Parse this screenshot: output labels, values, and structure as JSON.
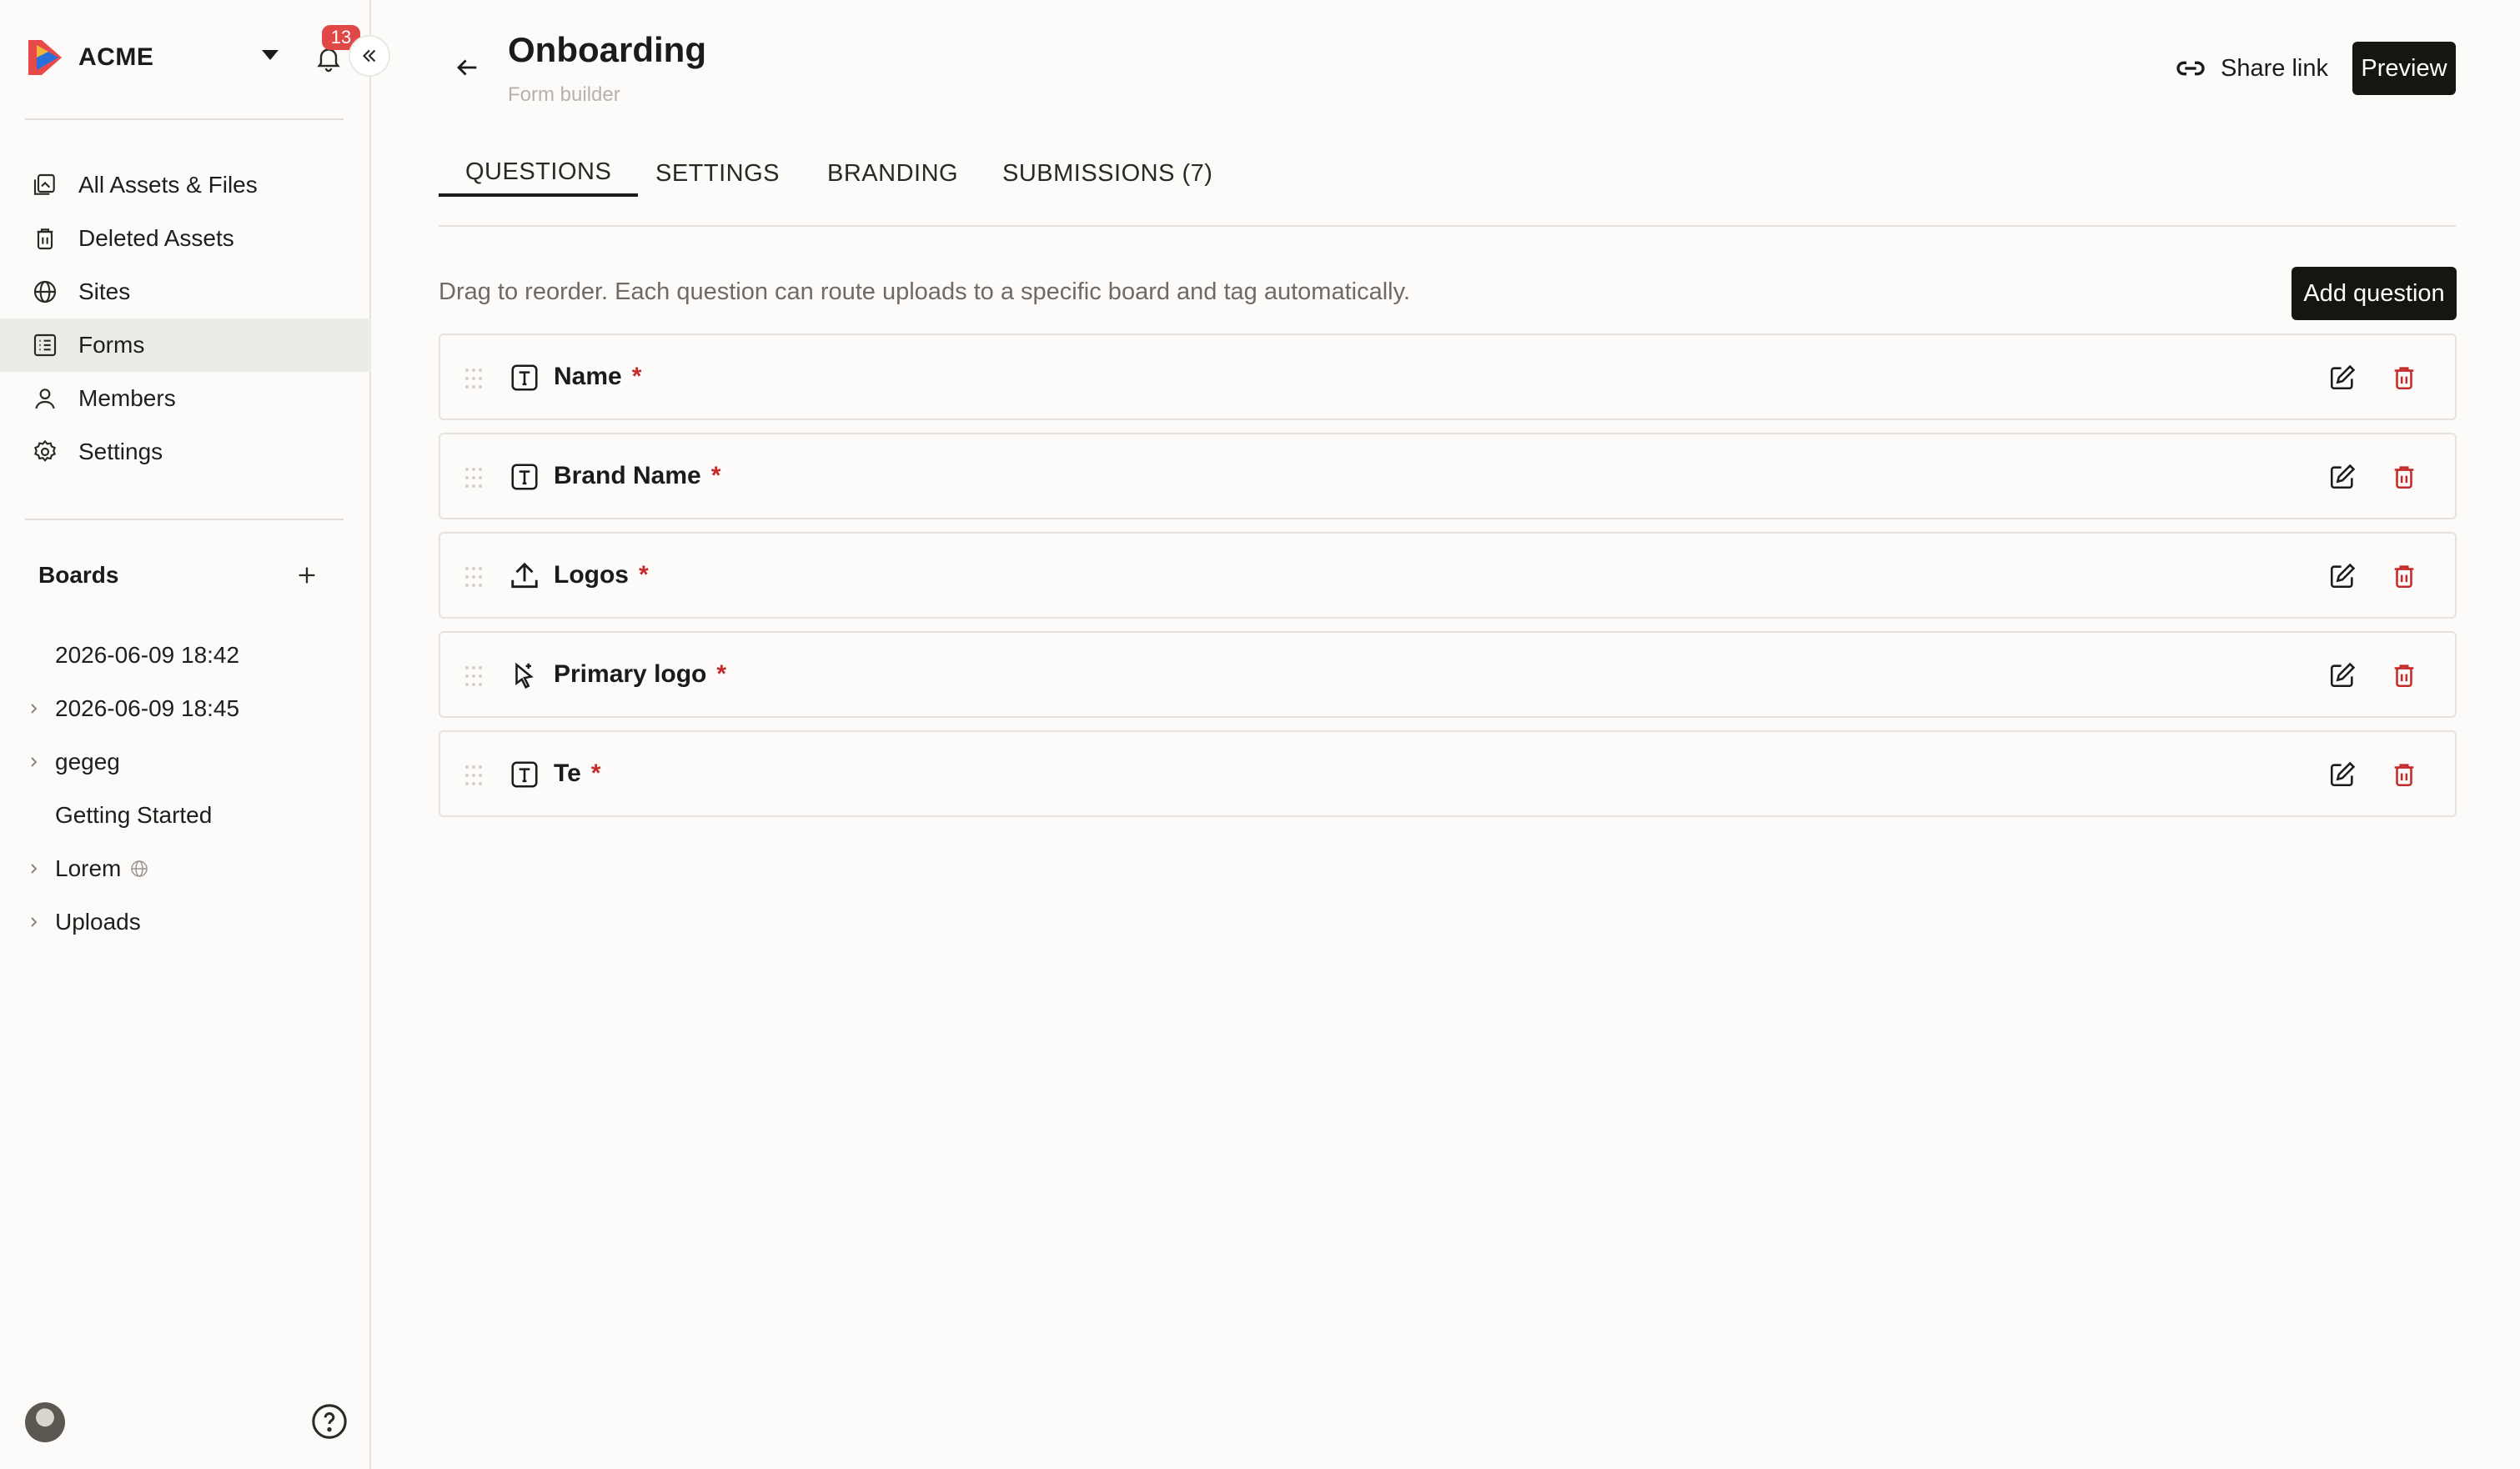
{
  "sidebar": {
    "brand_name": "ACME",
    "notification_count": "13",
    "nav": [
      {
        "label": "All Assets & Files",
        "icon": "assets-icon"
      },
      {
        "label": "Deleted Assets",
        "icon": "trash-icon"
      },
      {
        "label": "Sites",
        "icon": "globe-icon"
      },
      {
        "label": "Forms",
        "icon": "form-icon",
        "active": true
      },
      {
        "label": "Members",
        "icon": "user-icon"
      },
      {
        "label": "Settings",
        "icon": "gear-icon"
      }
    ],
    "boards_title": "Boards",
    "boards": [
      {
        "label": "2026-06-09 18:42",
        "expandable": false
      },
      {
        "label": "2026-06-09 18:45",
        "expandable": true
      },
      {
        "label": "gegeg",
        "expandable": true
      },
      {
        "label": "Getting Started",
        "expandable": false
      },
      {
        "label": "Lorem",
        "expandable": true,
        "public": true
      },
      {
        "label": "Uploads",
        "expandable": true
      }
    ]
  },
  "header": {
    "title": "Onboarding",
    "subtitle": "Form builder",
    "share_label": "Share link",
    "preview_label": "Preview"
  },
  "tabs": [
    {
      "label": "QUESTIONS",
      "active": true
    },
    {
      "label": "SETTINGS"
    },
    {
      "label": "BRANDING"
    },
    {
      "label": "SUBMISSIONS (7)"
    }
  ],
  "questions_panel": {
    "hint": "Drag to reorder. Each question can route uploads to a specific board and tag automatically.",
    "add_label": "Add question",
    "required_marker": "*",
    "questions": [
      {
        "label": "Name",
        "type": "text",
        "required": true
      },
      {
        "label": "Brand Name",
        "type": "text",
        "required": true
      },
      {
        "label": "Logos",
        "type": "upload",
        "required": true
      },
      {
        "label": "Primary logo",
        "type": "select",
        "required": true
      },
      {
        "label": "Te",
        "type": "text",
        "required": true
      }
    ]
  },
  "colors": {
    "accent_dark": "#16150f",
    "required": "#c52a2a",
    "badge": "#e04848",
    "delete": "#c52a2a"
  }
}
